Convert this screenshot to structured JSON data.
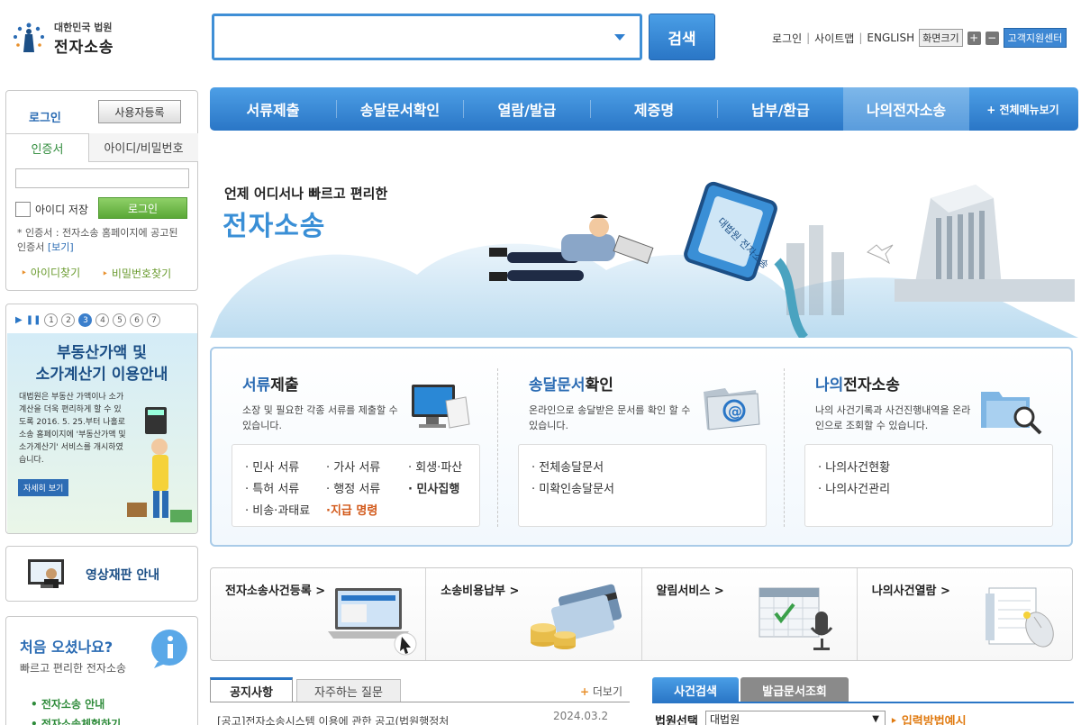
{
  "header": {
    "logo_top": "대한민국 법원",
    "logo_main": "전자소송",
    "search_placeholder": "",
    "search_button": "검색",
    "util": {
      "login": "로그인",
      "sitemap": "사이트맵",
      "english": "ENGLISH",
      "zoom": "화면크기",
      "plus": "+",
      "minus": "−",
      "support": "고객지원센터"
    }
  },
  "nav": {
    "items": [
      "서류제출",
      "송달문서확인",
      "열람/발급",
      "제증명",
      "납부/환급",
      "나의전자소송"
    ],
    "all_menu": "+ 전체메뉴보기"
  },
  "login": {
    "title": "로그인",
    "register": "사용자등록",
    "tab_cert": "인증서",
    "tab_id": "아이디/비밀번호",
    "save_id": "아이디 저장",
    "login_button": "로그인",
    "note": "* 인증서 : 전자소송 홈페이지에 공고된 인증서",
    "note_link": "[보기]",
    "find_id": "아이디찾기",
    "find_pw": "비밀번호찾기"
  },
  "banner": {
    "pages": [
      "1",
      "2",
      "3",
      "4",
      "5",
      "6",
      "7"
    ],
    "title_1": "부동산가액 및",
    "title_2": "소가계산기 이용안내",
    "desc": "대법원은 부동산 가액이나 소가 계산을 더욱 편리하게 할 수 있도록 2016. 5. 25.부터 나홀로소송 홈페이지에 '부동산가액 및 소가계산기' 서비스를 개시하였습니다.",
    "more": "자세히 보기"
  },
  "video": {
    "label": "영상재판 안내"
  },
  "first_visit": {
    "title": "처음 오셨나요?",
    "subtitle": "빠르고 편리한 전자소송",
    "link1": "• 전자소송 안내",
    "link2": "• 전자소송체험하기"
  },
  "hero": {
    "subtitle": "언제 어디서나 빠르고 편리한",
    "title": "전자소송",
    "sign_text": "대법원 전자소송"
  },
  "services": {
    "submit": {
      "title_hl": "서류",
      "title_rest": "제출",
      "desc": "소장 및 필요한 각종 서류를 제출할 수 있습니다.",
      "items": [
        "· 민사 서류",
        "· 가사 서류",
        "· 회생·파산",
        "· 특허 서류",
        "· 행정 서류",
        "· 민사집행",
        "· 비송·과태료",
        "·지급 명령"
      ]
    },
    "delivery": {
      "title_hl": "송달문서",
      "title_rest": "확인",
      "desc": "온라인으로 송달받은 문서를 확인 할 수 있습니다.",
      "items": [
        "· 전체송달문서",
        "· 미확인송달문서"
      ]
    },
    "my": {
      "title_hl": "나의",
      "title_rest": "전자소송",
      "desc": "나의 사건기록과 사건진행내역을 온라인으로 조회할 수 있습니다.",
      "items": [
        "· 나의사건현황",
        "· 나의사건관리"
      ]
    }
  },
  "quick": [
    "전자소송사건등록 >",
    "소송비용납부 >",
    "알림서비스 >",
    "나의사건열람 >"
  ],
  "notice": {
    "tab1": "공지사항",
    "tab2": "자주하는 질문",
    "more": "더보기",
    "item": "[공고]전자소송시스템 이용에 관한 공고(법원행정처",
    "date": "2024.03.2"
  },
  "case_search": {
    "tab1": "사건검색",
    "tab2": "발급문서조회",
    "court_label": "법원선택",
    "court_value": "대법원",
    "example": "입력방법예시"
  }
}
